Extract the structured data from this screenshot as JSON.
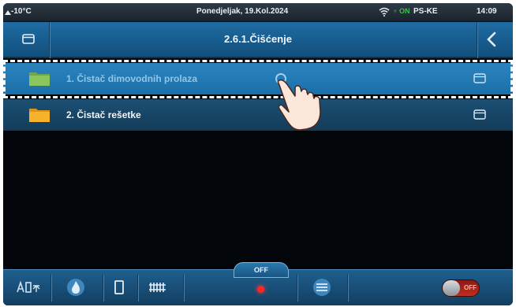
{
  "status_bar": {
    "outdoor_temp": "-10°C",
    "date": "Ponedjeljak, 19.Kol.2024",
    "connection_state": "ON",
    "user": "PS-KE",
    "time": "14:09"
  },
  "header": {
    "title": "2.6.1.Čišćenje"
  },
  "menu": {
    "items": [
      {
        "label": "1. Čistač dimovodnih prolaza",
        "selected": true
      },
      {
        "label": "2. Čistač rešetke",
        "selected": false
      }
    ]
  },
  "bottom_bar": {
    "mode_label": "OFF",
    "toggle_label": "OFF"
  },
  "colors": {
    "header_blue": "#1f6ca3",
    "selected_row": "#2b84bf",
    "row": "#1c4f73",
    "folder_yellow": "#f5b22a",
    "folder_green": "#7cb84f",
    "off_red": "#ff2525"
  },
  "icons": {
    "home": "home-icon",
    "back": "chevron-left-icon",
    "folder": "folder-icon",
    "hand": "tap-hand-icon"
  }
}
